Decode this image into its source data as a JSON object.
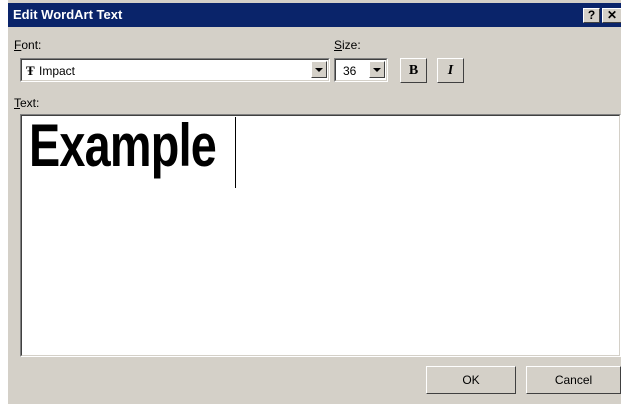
{
  "window": {
    "title": "Edit WordArt Text",
    "help_label": "?",
    "close_label": "✕"
  },
  "font": {
    "label_access": "F",
    "label_rest": "ont:",
    "value": "Impact",
    "icon": "truetype-font-icon"
  },
  "size": {
    "label_access": "S",
    "label_rest": "ize:",
    "value": "36"
  },
  "format": {
    "bold_label": "B",
    "italic_label": "I"
  },
  "text": {
    "label_access": "T",
    "label_rest": "ext:",
    "value": "Example"
  },
  "buttons": {
    "ok": "OK",
    "cancel": "Cancel"
  }
}
